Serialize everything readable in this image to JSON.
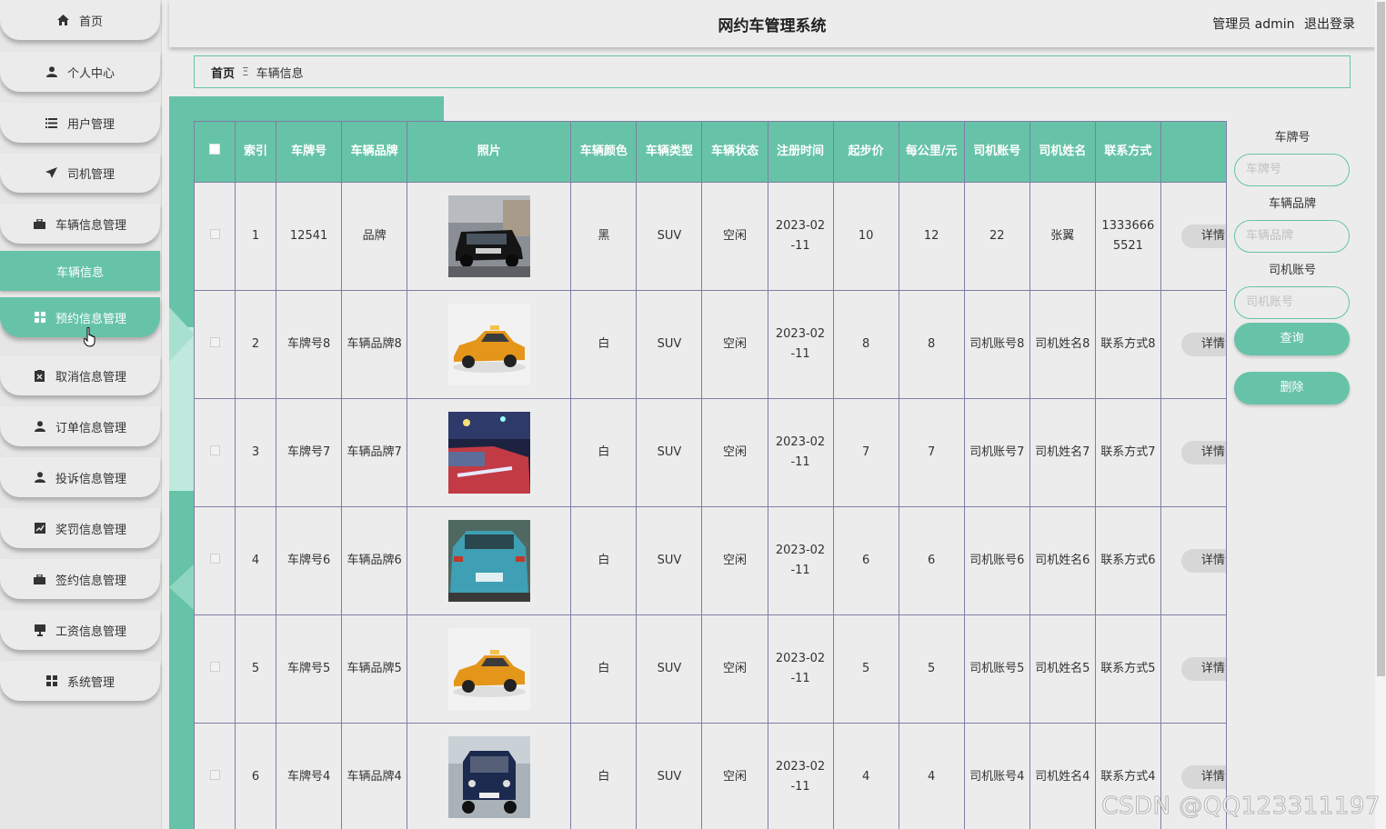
{
  "header": {
    "title": "网约车管理系统",
    "user_label": "管理员 admin",
    "logout": "退出登录"
  },
  "sidebar": {
    "items": [
      {
        "label": "首页",
        "icon": "home-icon"
      },
      {
        "label": "个人中心",
        "icon": "user-icon"
      },
      {
        "label": "用户管理",
        "icon": "list-icon"
      },
      {
        "label": "司机管理",
        "icon": "send-icon"
      },
      {
        "label": "车辆信息管理",
        "icon": "briefcase-icon"
      },
      {
        "label": "预约信息管理",
        "icon": "grid-icon"
      },
      {
        "label": "取消信息管理",
        "icon": "cancel-doc-icon"
      },
      {
        "label": "订单信息管理",
        "icon": "person-icon"
      },
      {
        "label": "投诉信息管理",
        "icon": "person-icon"
      },
      {
        "label": "奖罚信息管理",
        "icon": "chart-icon"
      },
      {
        "label": "签约信息管理",
        "icon": "bag-icon"
      },
      {
        "label": "工资信息管理",
        "icon": "monitor-icon"
      },
      {
        "label": "系统管理",
        "icon": "grid-icon"
      }
    ],
    "sub_item": "车辆信息"
  },
  "breadcrumb": {
    "home": "首页",
    "sep": "Ξ",
    "current": "车辆信息"
  },
  "table": {
    "headers": [
      "索引",
      "车牌号",
      "车辆品牌",
      "照片",
      "车辆颜色",
      "车辆类型",
      "车辆状态",
      "注册时间",
      "起步价",
      "每公里/元",
      "司机账号",
      "司机姓名",
      "联系方式"
    ],
    "detail_label": "详情",
    "rows": [
      {
        "idx": "1",
        "plate": "12541",
        "brand": "品牌",
        "color": "黑",
        "type": "SUV",
        "status": "空闲",
        "reg": "2023-02-11",
        "start": "10",
        "perkm": "12",
        "acct": "22",
        "name": "张翼",
        "contact": "13336665521"
      },
      {
        "idx": "2",
        "plate": "车牌号8",
        "brand": "车辆品牌8",
        "color": "白",
        "type": "SUV",
        "status": "空闲",
        "reg": "2023-02-11",
        "start": "8",
        "perkm": "8",
        "acct": "司机账号8",
        "name": "司机姓名8",
        "contact": "联系方式8"
      },
      {
        "idx": "3",
        "plate": "车牌号7",
        "brand": "车辆品牌7",
        "color": "白",
        "type": "SUV",
        "status": "空闲",
        "reg": "2023-02-11",
        "start": "7",
        "perkm": "7",
        "acct": "司机账号7",
        "name": "司机姓名7",
        "contact": "联系方式7"
      },
      {
        "idx": "4",
        "plate": "车牌号6",
        "brand": "车辆品牌6",
        "color": "白",
        "type": "SUV",
        "status": "空闲",
        "reg": "2023-02-11",
        "start": "6",
        "perkm": "6",
        "acct": "司机账号6",
        "name": "司机姓名6",
        "contact": "联系方式6"
      },
      {
        "idx": "5",
        "plate": "车牌号5",
        "brand": "车辆品牌5",
        "color": "白",
        "type": "SUV",
        "status": "空闲",
        "reg": "2023-02-11",
        "start": "5",
        "perkm": "5",
        "acct": "司机账号5",
        "name": "司机姓名5",
        "contact": "联系方式5"
      },
      {
        "idx": "6",
        "plate": "车牌号4",
        "brand": "车辆品牌4",
        "color": "白",
        "type": "SUV",
        "status": "空闲",
        "reg": "2023-02-11",
        "start": "4",
        "perkm": "4",
        "acct": "司机账号4",
        "name": "司机姓名4",
        "contact": "联系方式4"
      }
    ]
  },
  "search": {
    "plate_label": "车牌号",
    "plate_placeholder": "车牌号",
    "brand_label": "车辆品牌",
    "brand_placeholder": "车辆品牌",
    "acct_label": "司机账号",
    "acct_placeholder": "司机账号",
    "query": "查询",
    "delete": "删除"
  },
  "watermark": "CSDN @QQ123311197",
  "colors": {
    "accent": "#67c3a7",
    "border": "#7d7fa5"
  }
}
